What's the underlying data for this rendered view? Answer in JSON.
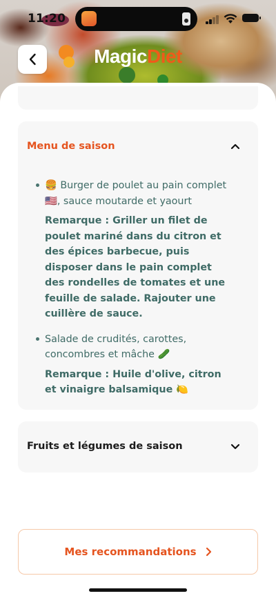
{
  "status_bar": {
    "time": "11:20"
  },
  "header": {
    "logo_part1": "Magic",
    "logo_part2": "Diet",
    "back_icon": "chevron-left-icon"
  },
  "sections": [
    {
      "title": "Menu de saison",
      "expanded": true,
      "icon": "chevron-up-icon",
      "items": [
        {
          "emoji": "🍔",
          "text_before_flag": "Burger de poulet au pain complet",
          "flag": "🇺🇸",
          "text_after_flag": ", sauce moutarde et yaourt",
          "note": "Remarque : Griller un filet de poulet mariné dans du citron et des épices barbecue, puis disposer dans le pain complet des rondelles de tomates et une feuille de salade. Rajouter une cuillère de sauce."
        },
        {
          "text": "Salade de crudités, carottes, concombres et mâche",
          "emoji_after": "🥒",
          "note": "Remarque : Huile d'olive, citron et vinaigre balsamique",
          "note_emoji": "🍋"
        }
      ]
    },
    {
      "title": "Fruits et légumes de saison",
      "expanded": false,
      "icon": "chevron-down-icon"
    }
  ],
  "cta": {
    "label": "Mes recommandations",
    "icon": "chevron-right-icon"
  },
  "colors": {
    "accent": "#e5541f",
    "text_teal": "#3f6b66",
    "card_bg": "#f7f7f7"
  }
}
